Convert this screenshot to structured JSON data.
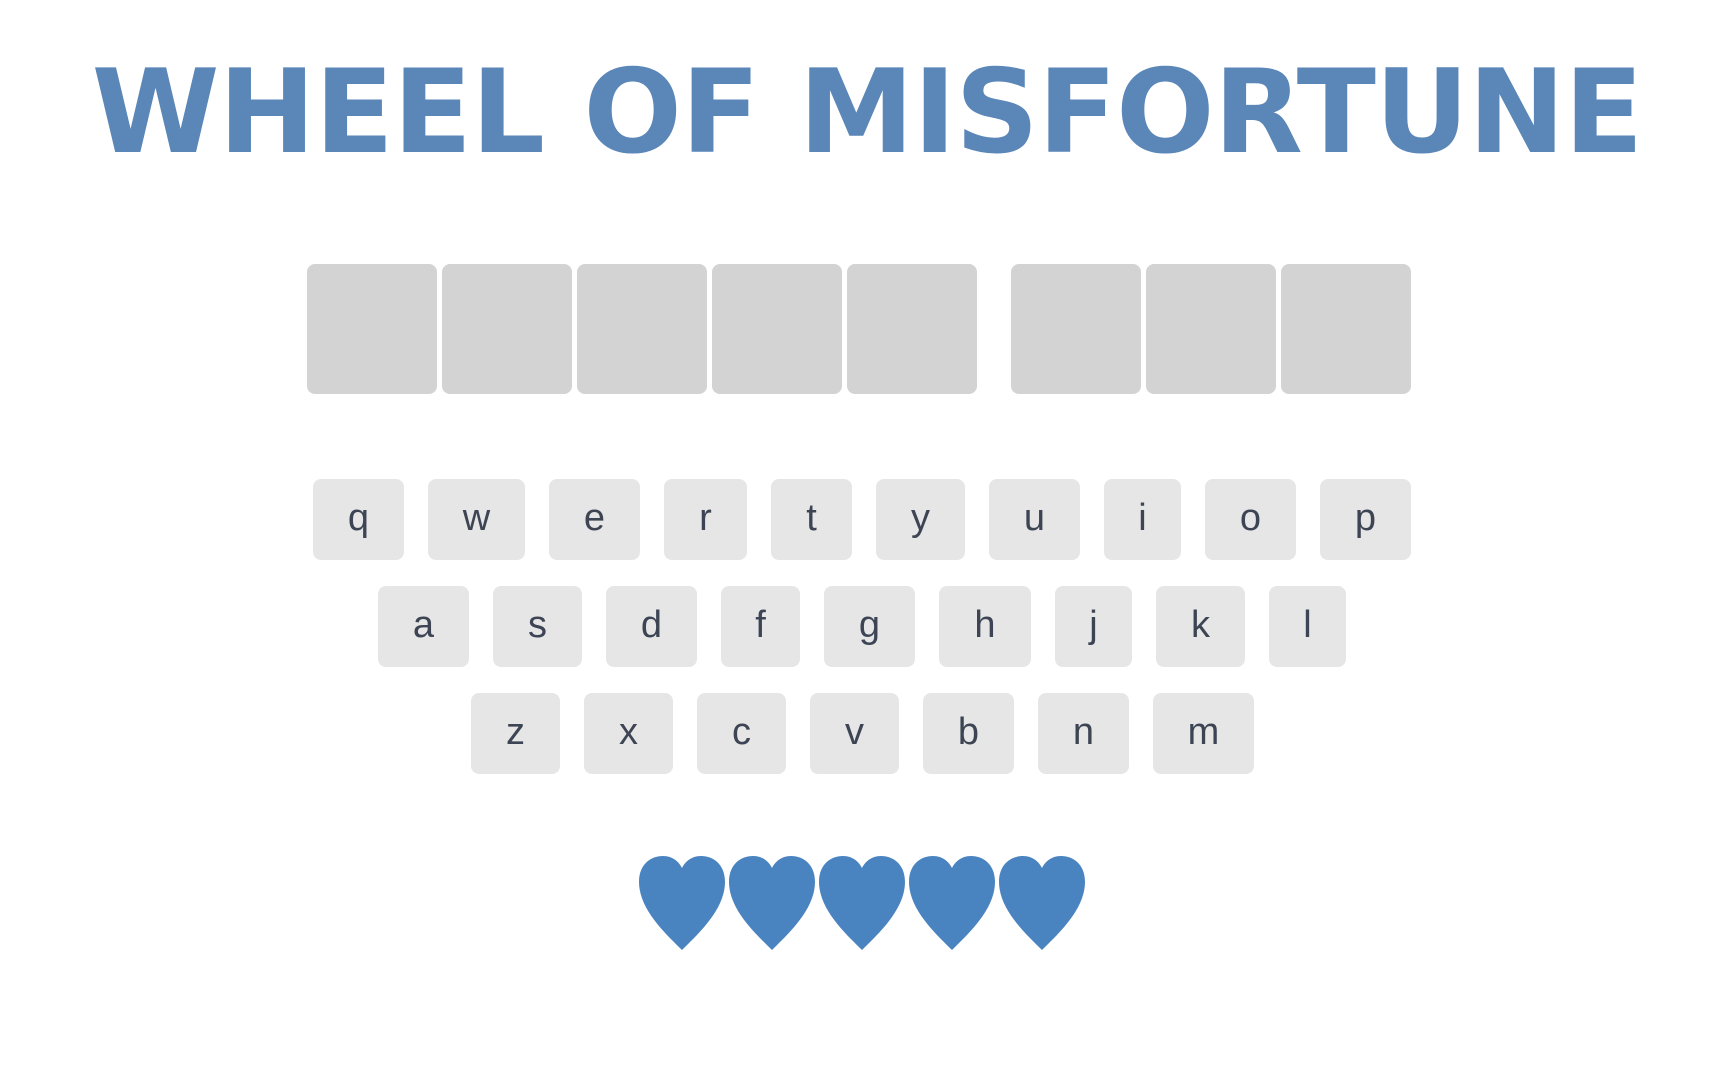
{
  "title": "WHEEL OF MISFORTUNE",
  "puzzle": {
    "words": [
      {
        "tiles": [
          "",
          "",
          "",
          "",
          ""
        ]
      },
      {
        "tiles": [
          "",
          "",
          ""
        ]
      }
    ],
    "tile_color": "#d3d3d3"
  },
  "keyboard": {
    "rows": [
      [
        "q",
        "w",
        "e",
        "r",
        "t",
        "y",
        "u",
        "i",
        "o",
        "p"
      ],
      [
        "a",
        "s",
        "d",
        "f",
        "g",
        "h",
        "j",
        "k",
        "l"
      ],
      [
        "z",
        "x",
        "c",
        "v",
        "b",
        "n",
        "m"
      ]
    ],
    "key_color": "#e6e6e6",
    "key_text_color": "#3d4554"
  },
  "lives": {
    "remaining": 5,
    "icon": "heart-icon",
    "color": "#4a84c0"
  },
  "colors": {
    "title": "#5a86b8",
    "background": "#ffffff"
  }
}
